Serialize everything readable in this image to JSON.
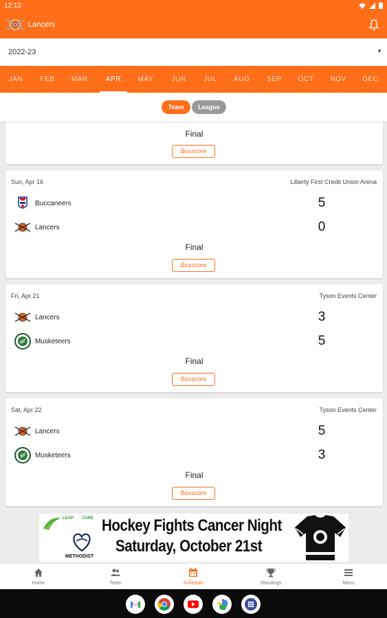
{
  "status_bar": {
    "time": "12:12"
  },
  "app": {
    "title": "Lancers"
  },
  "season": {
    "value": "2022-23"
  },
  "months": [
    {
      "label": "JAN"
    },
    {
      "label": "FEB"
    },
    {
      "label": "MAR"
    },
    {
      "label": "APR"
    },
    {
      "label": "MAY"
    },
    {
      "label": "JUN"
    },
    {
      "label": "JUL"
    },
    {
      "label": "AUG"
    },
    {
      "label": "SEP"
    },
    {
      "label": "OCT"
    },
    {
      "label": "NOV"
    },
    {
      "label": "DEC"
    }
  ],
  "active_month": "APR",
  "filters": {
    "team": "Team",
    "league": "League",
    "active": "Team"
  },
  "partial_card": {
    "status": "Final",
    "boxscore_label": "Boxscore"
  },
  "games": [
    {
      "date": "Sun, Apr 16",
      "venue": "Liberty First Credit Union Arena",
      "teams": [
        {
          "name": "Buccaneers",
          "score": "5",
          "logo": "buccaneers-logo"
        },
        {
          "name": "Lancers",
          "score": "0",
          "logo": "lancers-logo"
        }
      ],
      "status": "Final",
      "boxscore_label": "Boxscore"
    },
    {
      "date": "Fri, Apr 21",
      "venue": "Tyson Events Center",
      "teams": [
        {
          "name": "Lancers",
          "score": "3",
          "logo": "lancers-logo"
        },
        {
          "name": "Musketeers",
          "score": "5",
          "logo": "musketeers-logo"
        }
      ],
      "status": "Final",
      "boxscore_label": "Boxscore"
    },
    {
      "date": "Sat, Apr 22",
      "venue": "Tyson Events Center",
      "teams": [
        {
          "name": "Lancers",
          "score": "5",
          "logo": "lancers-logo"
        },
        {
          "name": "Musketeers",
          "score": "3",
          "logo": "musketeers-logo"
        }
      ],
      "status": "Final",
      "boxscore_label": "Boxscore"
    }
  ],
  "banner": {
    "line1": "Hockey Fights Cancer Night",
    "line2": "Saturday, October 21st",
    "sponsor_leap": "LEAP",
    "sponsor_cure": "CURE",
    "sponsor_methodist": "METHODIST"
  },
  "bottom_nav": [
    {
      "label": "Home",
      "icon": "home-icon"
    },
    {
      "label": "Team",
      "icon": "people-icon"
    },
    {
      "label": "Schedule",
      "icon": "calendar-icon"
    },
    {
      "label": "Standings",
      "icon": "trophy-icon"
    },
    {
      "label": "Menu",
      "icon": "menu-icon"
    }
  ],
  "active_nav": "Schedule",
  "dock_apps": [
    "gmail-icon",
    "chrome-icon",
    "youtube-icon",
    "photos-icon",
    "apps-icon"
  ],
  "colors": {
    "accent": "#ff6f1a",
    "chip_inactive": "#9a9a9a",
    "background": "#ececec"
  }
}
